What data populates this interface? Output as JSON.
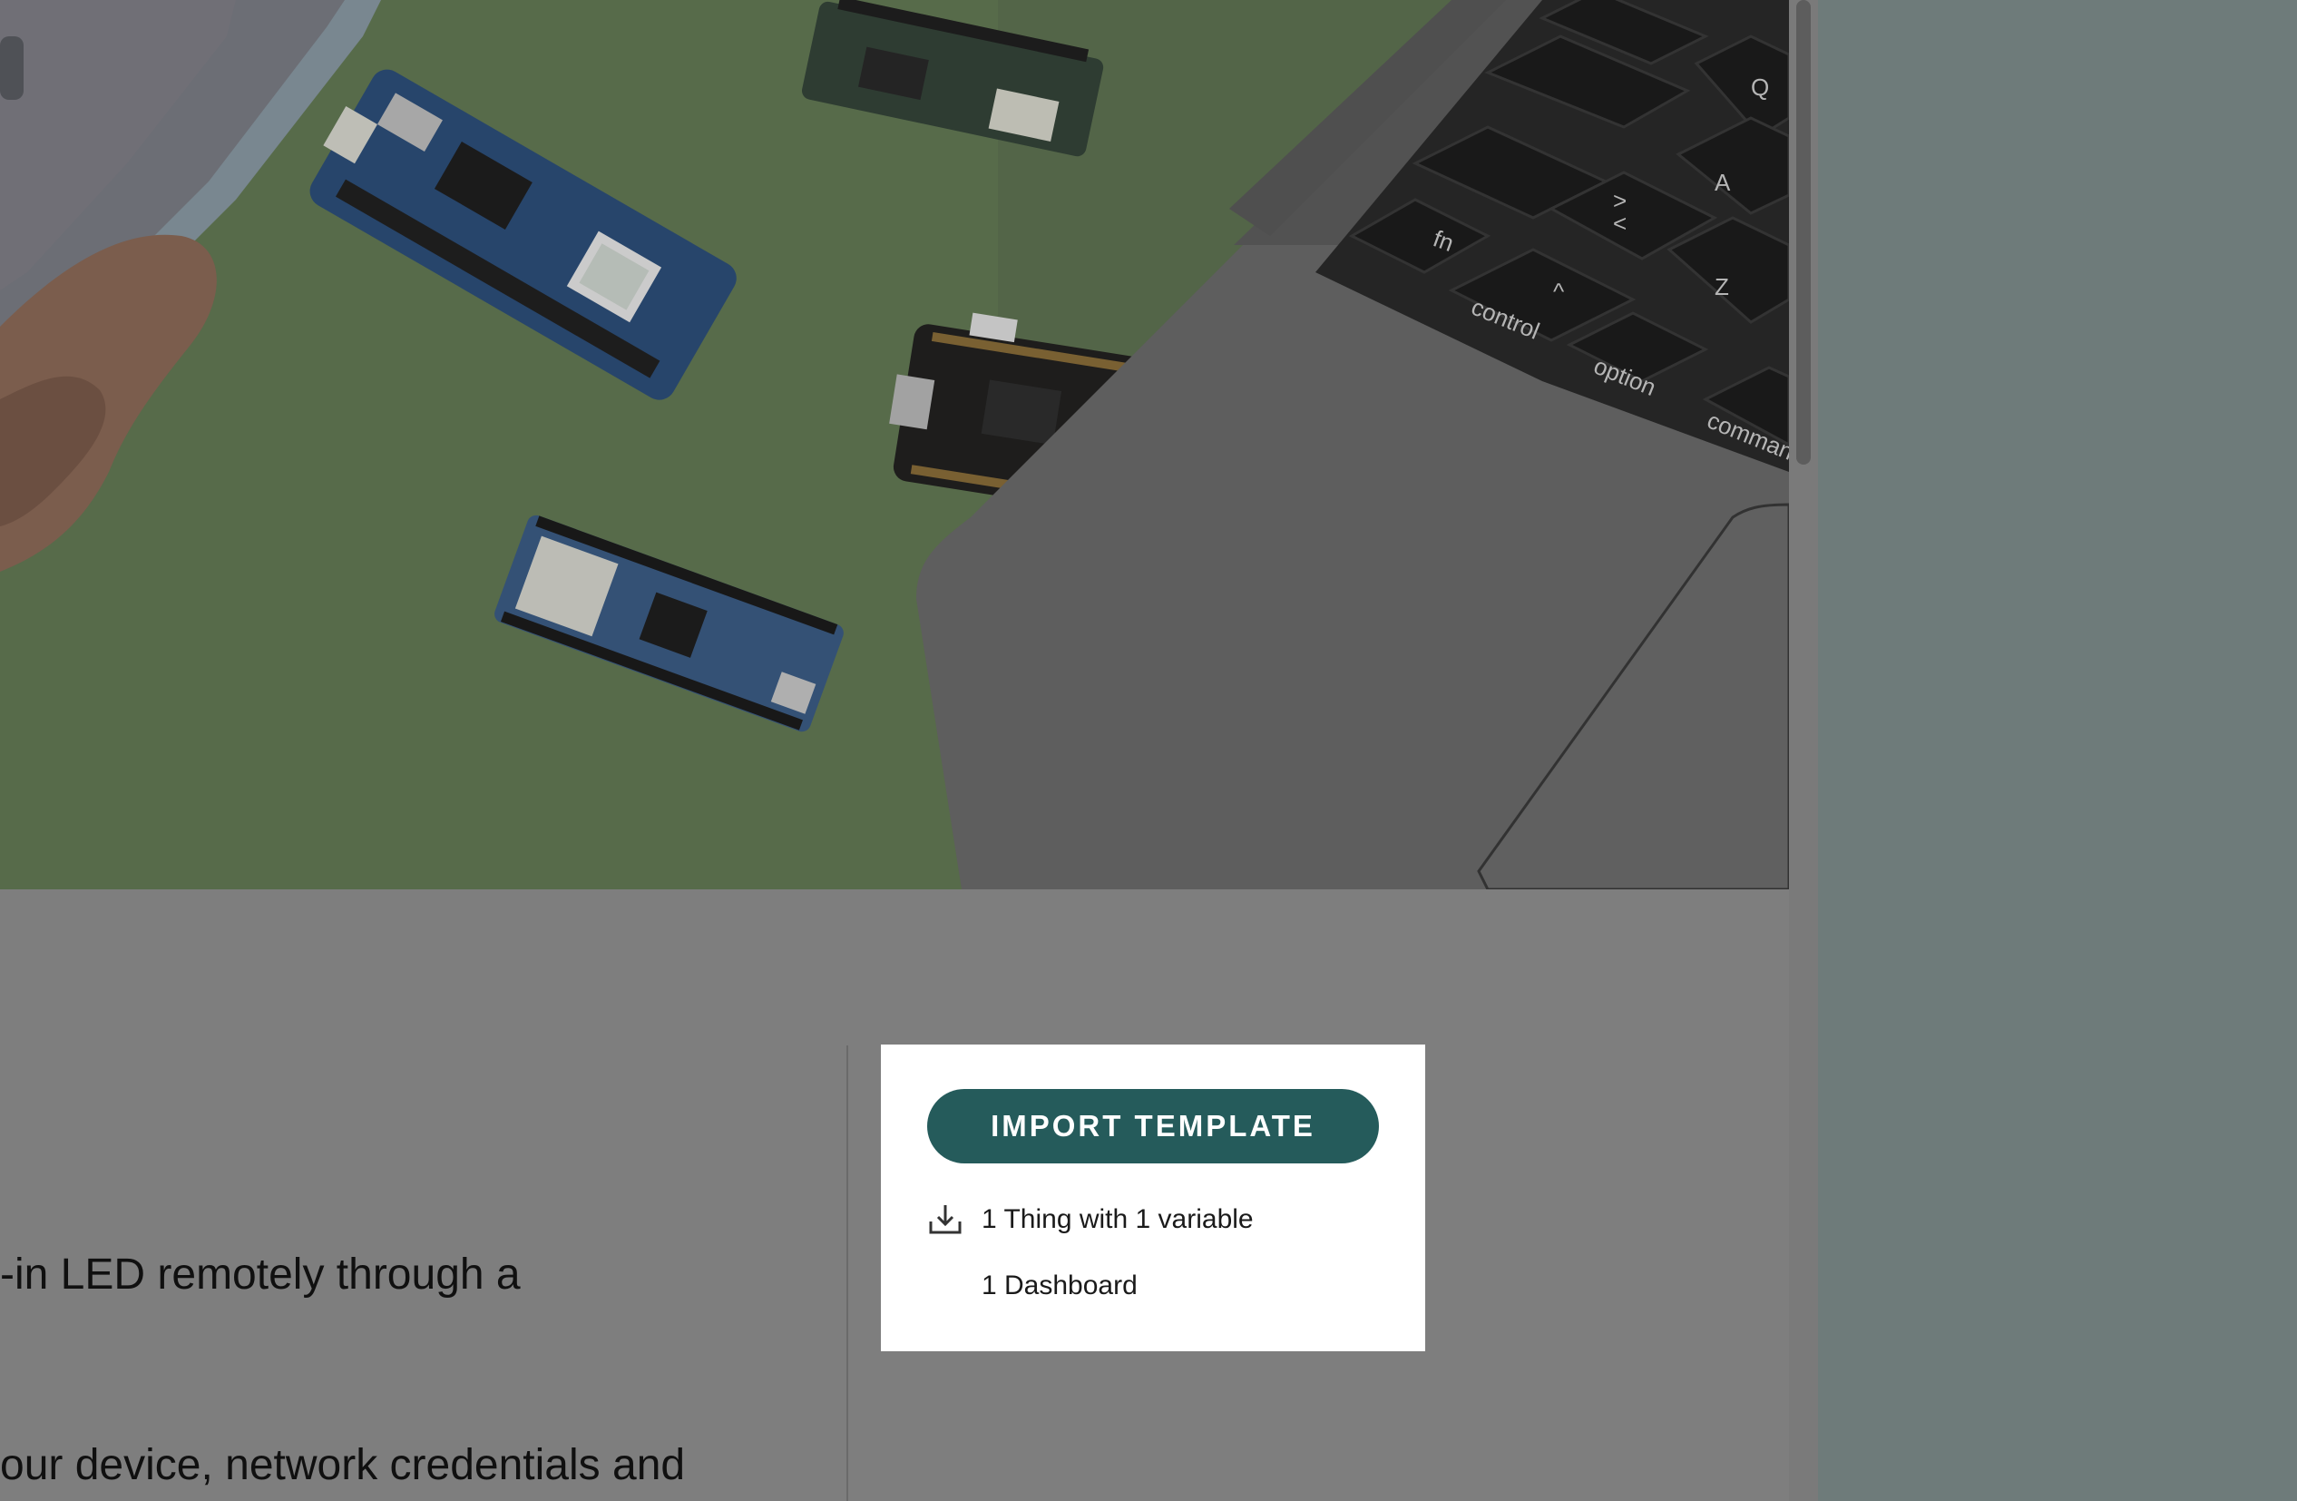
{
  "hero_image": {
    "alt": "Arduino boards on green surface next to a laptop keyboard",
    "key_labels": [
      "Q",
      "A",
      "Z",
      "fn",
      "control",
      "option",
      "comman",
      "<",
      ">",
      "^"
    ]
  },
  "description": {
    "line1": "-in LED remotely through a",
    "line2": "our device, network credentials and"
  },
  "import_card": {
    "button_label": "IMPORT TEMPLATE",
    "includes": [
      {
        "icon": "download-icon",
        "text": "1 Thing with 1 variable"
      },
      {
        "icon": "",
        "text": "1 Dashboard"
      }
    ]
  },
  "colors": {
    "accent": "#255b5b",
    "overlay_background": "#7e7e7e",
    "side_background": "#6e7b7a",
    "card_background": "#ffffff"
  }
}
